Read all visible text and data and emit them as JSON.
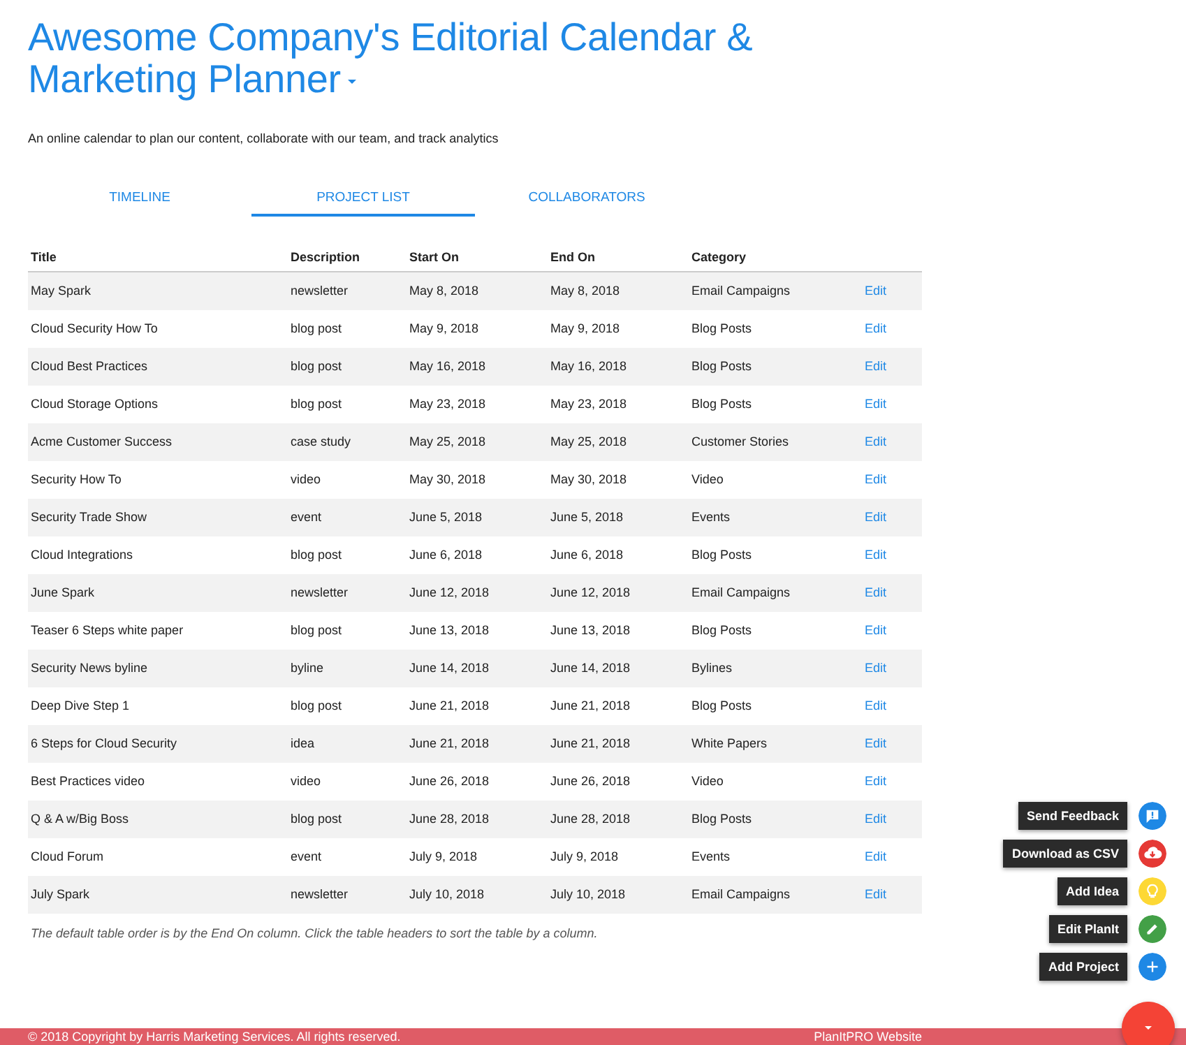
{
  "header": {
    "title": "Awesome Company's Editorial Calendar & Marketing Planner",
    "subtitle": "An online calendar to plan our content, collaborate with our team, and track analytics"
  },
  "tabs": [
    {
      "label": "TIMELINE",
      "selected": false
    },
    {
      "label": "PROJECT LIST",
      "selected": true
    },
    {
      "label": "COLLABORATORS",
      "selected": false
    }
  ],
  "table": {
    "columns": [
      "Title",
      "Description",
      "Start On",
      "End On",
      "Category"
    ],
    "rows": [
      {
        "cells": [
          "May Spark",
          "newsletter",
          "May 8, 2018",
          "May 8, 2018",
          "Email Campaigns"
        ],
        "action": "Edit"
      },
      {
        "cells": [
          "Cloud Security How To",
          "blog post",
          "May 9, 2018",
          "May 9, 2018",
          "Blog Posts"
        ],
        "action": "Edit"
      },
      {
        "cells": [
          "Cloud Best Practices",
          "blog post",
          "May 16, 2018",
          "May 16, 2018",
          "Blog Posts"
        ],
        "action": "Edit"
      },
      {
        "cells": [
          "Cloud Storage Options",
          "blog post",
          "May 23, 2018",
          "May 23, 2018",
          "Blog Posts"
        ],
        "action": "Edit"
      },
      {
        "cells": [
          "Acme Customer Success",
          "case study",
          "May 25, 2018",
          "May 25, 2018",
          "Customer Stories"
        ],
        "action": "Edit"
      },
      {
        "cells": [
          "Security How To",
          "video",
          "May 30, 2018",
          "May 30, 2018",
          "Video"
        ],
        "action": "Edit"
      },
      {
        "cells": [
          "Security Trade Show",
          "event",
          "June 5, 2018",
          "June 5, 2018",
          "Events"
        ],
        "action": "Edit"
      },
      {
        "cells": [
          "Cloud Integrations",
          "blog post",
          "June 6, 2018",
          "June 6, 2018",
          "Blog Posts"
        ],
        "action": "Edit"
      },
      {
        "cells": [
          "June Spark",
          "newsletter",
          "June 12, 2018",
          "June 12, 2018",
          "Email Campaigns"
        ],
        "action": "Edit"
      },
      {
        "cells": [
          "Teaser 6 Steps white paper",
          "blog post",
          "June 13, 2018",
          "June 13, 2018",
          "Blog Posts"
        ],
        "action": "Edit"
      },
      {
        "cells": [
          "Security News byline",
          "byline",
          "June 14, 2018",
          "June 14, 2018",
          "Bylines"
        ],
        "action": "Edit"
      },
      {
        "cells": [
          "Deep Dive Step 1",
          "blog post",
          "June 21, 2018",
          "June 21, 2018",
          "Blog Posts"
        ],
        "action": "Edit"
      },
      {
        "cells": [
          "6 Steps for Cloud Security",
          "idea",
          "June 21, 2018",
          "June 21, 2018",
          "White Papers"
        ],
        "action": "Edit"
      },
      {
        "cells": [
          "Best Practices video",
          "video",
          "June 26, 2018",
          "June 26, 2018",
          "Video"
        ],
        "action": "Edit"
      },
      {
        "cells": [
          "Q & A w/Big Boss",
          "blog post",
          "June 28, 2018",
          "June 28, 2018",
          "Blog Posts"
        ],
        "action": "Edit"
      },
      {
        "cells": [
          "Cloud Forum",
          "event",
          "July 9, 2018",
          "July 9, 2018",
          "Events"
        ],
        "action": "Edit"
      },
      {
        "cells": [
          "July Spark",
          "newsletter",
          "July 10, 2018",
          "July 10, 2018",
          "Email Campaigns"
        ],
        "action": "Edit"
      }
    ],
    "note": "The default table order is by the End On column. Click the table headers to sort the table by a column."
  },
  "actions": [
    {
      "label": "Send Feedback",
      "kind": "feedback",
      "color": "#1e88e5"
    },
    {
      "label": "Download as CSV",
      "kind": "download",
      "color": "#e53935"
    },
    {
      "label": "Add Idea",
      "kind": "idea",
      "color": "#fdd835"
    },
    {
      "label": "Edit PlanIt",
      "kind": "edit",
      "color": "#43a047"
    },
    {
      "label": "Add Project",
      "kind": "add",
      "color": "#1e88e5"
    }
  ],
  "footer": {
    "copyright": "© 2018 Copyright by Harris Marketing Services. All rights reserved.",
    "link": "PlanItPRO Website"
  }
}
